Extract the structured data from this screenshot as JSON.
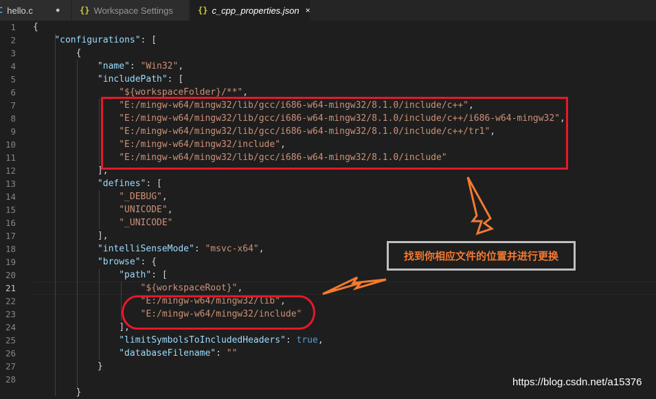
{
  "tabs": [
    {
      "icon": "C",
      "label": "hello.c",
      "marker": "●",
      "active": false,
      "icon_color": "#519aba"
    },
    {
      "icon": "{}",
      "label": "Workspace Settings",
      "marker": "",
      "active": false,
      "icon_color": "#cbcb41"
    },
    {
      "icon": "{}",
      "label": "c_cpp_properties.json",
      "marker": "×",
      "active": true,
      "icon_color": "#cbcb41"
    }
  ],
  "lines": [
    {
      "n": "1",
      "t": [
        [
          "p",
          "{"
        ]
      ]
    },
    {
      "n": "2",
      "t": [
        [
          "p",
          "    "
        ],
        [
          "k",
          "\"configurations\""
        ],
        [
          "p",
          ": ["
        ]
      ]
    },
    {
      "n": "3",
      "t": [
        [
          "p",
          "        {"
        ]
      ]
    },
    {
      "n": "4",
      "t": [
        [
          "p",
          "            "
        ],
        [
          "k",
          "\"name\""
        ],
        [
          "p",
          ": "
        ],
        [
          "s",
          "\"Win32\""
        ],
        [
          "p",
          ","
        ]
      ]
    },
    {
      "n": "5",
      "t": [
        [
          "p",
          "            "
        ],
        [
          "k",
          "\"includePath\""
        ],
        [
          "p",
          ": ["
        ]
      ]
    },
    {
      "n": "6",
      "t": [
        [
          "p",
          "                "
        ],
        [
          "s",
          "\"${workspaceFolder}/**\""
        ],
        [
          "p",
          ","
        ]
      ]
    },
    {
      "n": "7",
      "t": [
        [
          "p",
          "                "
        ],
        [
          "s",
          "\"E:/mingw-w64/mingw32/lib/gcc/i686-w64-mingw32/8.1.0/include/c++\""
        ],
        [
          "p",
          ","
        ]
      ]
    },
    {
      "n": "8",
      "t": [
        [
          "p",
          "                "
        ],
        [
          "s",
          "\"E:/mingw-w64/mingw32/lib/gcc/i686-w64-mingw32/8.1.0/include/c++/i686-w64-mingw32\""
        ],
        [
          "p",
          ","
        ]
      ]
    },
    {
      "n": "9",
      "t": [
        [
          "p",
          "                "
        ],
        [
          "s",
          "\"E:/mingw-w64/mingw32/lib/gcc/i686-w64-mingw32/8.1.0/include/c++/tr1\""
        ],
        [
          "p",
          ","
        ]
      ]
    },
    {
      "n": "10",
      "t": [
        [
          "p",
          "                "
        ],
        [
          "s",
          "\"E:/mingw-w64/mingw32/include\""
        ],
        [
          "p",
          ","
        ]
      ]
    },
    {
      "n": "11",
      "t": [
        [
          "p",
          "                "
        ],
        [
          "s",
          "\"E:/mingw-w64/mingw32/lib/gcc/i686-w64-mingw32/8.1.0/include\""
        ]
      ]
    },
    {
      "n": "12",
      "t": [
        [
          "p",
          "            ],"
        ]
      ]
    },
    {
      "n": "13",
      "t": [
        [
          "p",
          "            "
        ],
        [
          "k",
          "\"defines\""
        ],
        [
          "p",
          ": ["
        ]
      ]
    },
    {
      "n": "14",
      "t": [
        [
          "p",
          "                "
        ],
        [
          "s",
          "\"_DEBUG\""
        ],
        [
          "p",
          ","
        ]
      ]
    },
    {
      "n": "15",
      "t": [
        [
          "p",
          "                "
        ],
        [
          "s",
          "\"UNICODE\""
        ],
        [
          "p",
          ","
        ]
      ]
    },
    {
      "n": "16",
      "t": [
        [
          "p",
          "                "
        ],
        [
          "s",
          "\"_UNICODE\""
        ]
      ]
    },
    {
      "n": "17",
      "t": [
        [
          "p",
          "            ],"
        ]
      ]
    },
    {
      "n": "18",
      "t": [
        [
          "p",
          "            "
        ],
        [
          "k",
          "\"intelliSenseMode\""
        ],
        [
          "p",
          ": "
        ],
        [
          "s",
          "\"msvc-x64\""
        ],
        [
          "p",
          ","
        ]
      ]
    },
    {
      "n": "19",
      "t": [
        [
          "p",
          "            "
        ],
        [
          "k",
          "\"browse\""
        ],
        [
          "p",
          ": {"
        ]
      ]
    },
    {
      "n": "20",
      "t": [
        [
          "p",
          "                "
        ],
        [
          "k",
          "\"path\""
        ],
        [
          "p",
          ": ["
        ]
      ]
    },
    {
      "n": "21",
      "t": [
        [
          "p",
          "                    "
        ],
        [
          "s",
          "\"${workspaceRoot}\""
        ],
        [
          "p",
          ","
        ]
      ]
    },
    {
      "n": "22",
      "t": [
        [
          "p",
          "                    "
        ],
        [
          "s",
          "\"E:/mingw-w64/mingw32/lib\""
        ],
        [
          "p",
          ","
        ]
      ]
    },
    {
      "n": "23",
      "t": [
        [
          "p",
          "                    "
        ],
        [
          "s",
          "\"E:/mingw-w64/mingw32/include\""
        ]
      ]
    },
    {
      "n": "24",
      "t": [
        [
          "p",
          "                ],"
        ]
      ]
    },
    {
      "n": "25",
      "t": [
        [
          "p",
          "                "
        ],
        [
          "k",
          "\"limitSymbolsToIncludedHeaders\""
        ],
        [
          "p",
          ": "
        ],
        [
          "b",
          "true"
        ],
        [
          "p",
          ","
        ]
      ]
    },
    {
      "n": "26",
      "t": [
        [
          "p",
          "                "
        ],
        [
          "k",
          "\"databaseFilename\""
        ],
        [
          "p",
          ": "
        ],
        [
          "s",
          "\"\""
        ]
      ]
    },
    {
      "n": "27",
      "t": [
        [
          "p",
          "            }"
        ]
      ]
    },
    {
      "n": "28",
      "t": [
        [
          "p",
          ""
        ]
      ]
    },
    {
      "n": "",
      "t": [
        [
          "p",
          "        }"
        ]
      ]
    }
  ],
  "annotation": {
    "text": "找到你相应文件的位置并进行更换"
  },
  "watermark": "https://blog.csdn.net/a15376",
  "colors": {
    "key": "#9cdcfe",
    "string": "#ce9178",
    "bool": "#569cd6",
    "highlight": "#e8182a",
    "arrow": "#f47a30"
  }
}
